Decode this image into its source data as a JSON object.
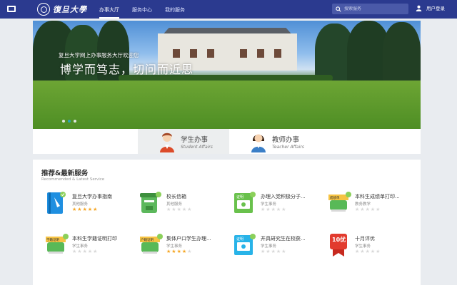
{
  "header": {
    "logo_text": "復旦大學",
    "nav": [
      {
        "label": "办事大厅",
        "active": true
      },
      {
        "label": "服务中心",
        "active": false
      },
      {
        "label": "我的服务",
        "active": false
      }
    ],
    "search_placeholder": "搜索服务",
    "user_label": "用户登录"
  },
  "banner": {
    "subtitle": "复旦大学网上办事服务大厅欢迎您",
    "title": "博学而笃志，切问而近思",
    "slides": 3,
    "active_slide": 2
  },
  "affairs_tabs": [
    {
      "cn": "学生办事",
      "en": "Student Affairs",
      "active": true
    },
    {
      "cn": "教师办事",
      "en": "Teacher Affairs",
      "active": false
    }
  ],
  "services": {
    "title": "推荐&最新服务",
    "subtitle": "Recommended & Latest Service",
    "items": [
      {
        "name": "复旦大学办事指南",
        "category": "其他服务",
        "rating": 5,
        "icon": "book-icon",
        "icon_label": ""
      },
      {
        "name": "校长信箱",
        "category": "其他服务",
        "rating": 0,
        "icon": "mailbox-icon",
        "icon_label": ""
      },
      {
        "name": "办理入党积极分子...",
        "category": "学生事务",
        "rating": 0,
        "icon": "certificate-icon",
        "icon_label": "证明"
      },
      {
        "name": "本科生成绩单打印...",
        "category": "教务教学",
        "rating": 0,
        "icon": "transcript-icon",
        "icon_label": "成绩单"
      },
      {
        "name": "本科生学籍证明打印",
        "category": "学生事务",
        "rating": 0,
        "icon": "certificate-icon",
        "icon_label": "学籍证明"
      },
      {
        "name": "集体户口学生办理...",
        "category": "学生事务",
        "rating": 4,
        "icon": "certificate-icon",
        "icon_label": "户籍证明"
      },
      {
        "name": "开具研究生在校获...",
        "category": "学生事务",
        "rating": 0,
        "icon": "certificate-icon",
        "icon_label": "证明"
      },
      {
        "name": "十月评优",
        "category": "学生事务",
        "rating": 0,
        "icon": "award-icon",
        "icon_label": "10优"
      }
    ]
  },
  "colors": {
    "header": "#2b3a8f",
    "star_on": "#f5a623",
    "star_off": "#d8d8d8",
    "accent": "#28a6b4"
  }
}
